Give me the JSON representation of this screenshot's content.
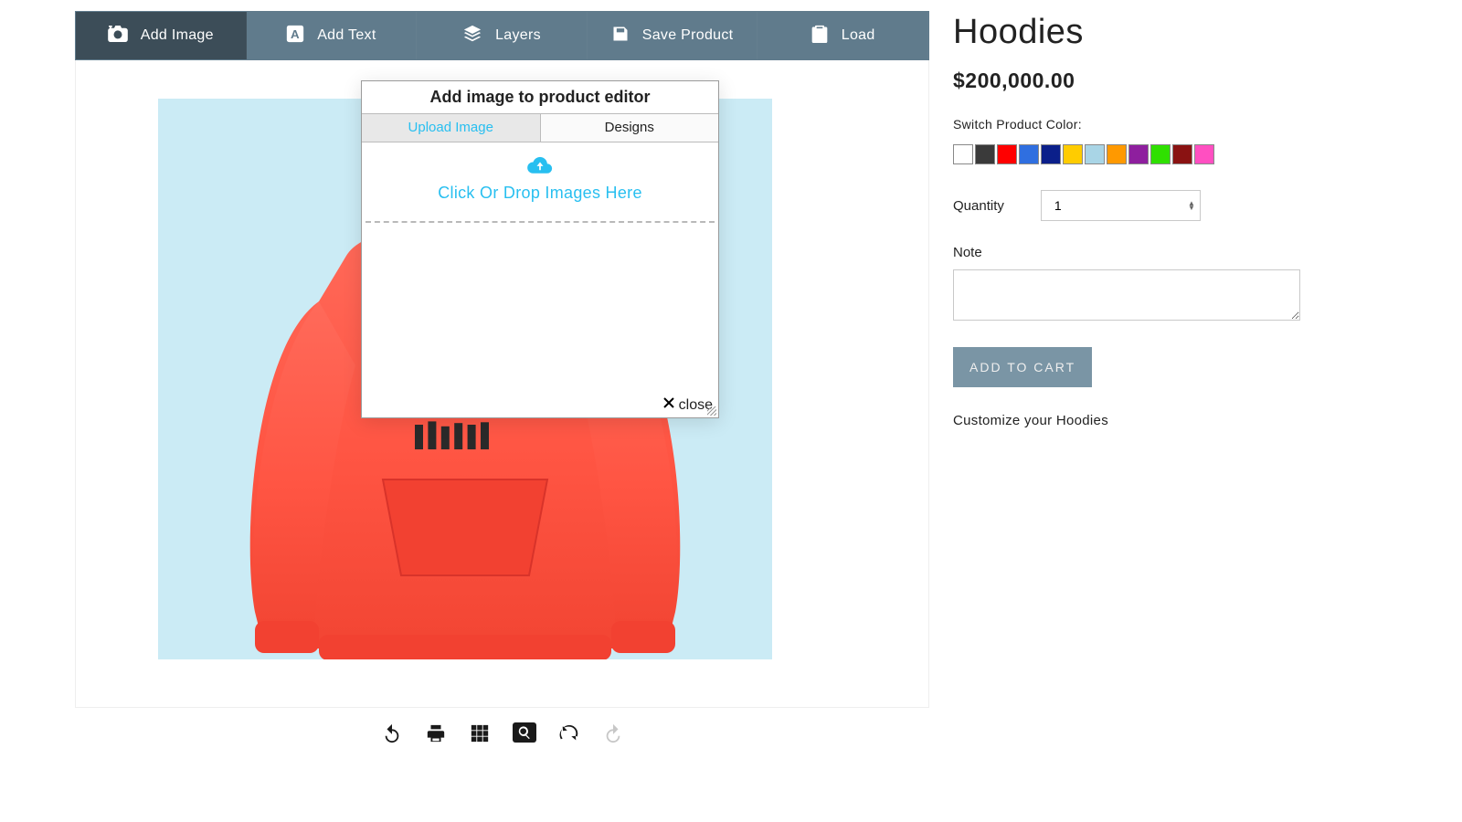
{
  "toolbar": {
    "add_image": "Add Image",
    "add_text": "Add Text",
    "layers": "Layers",
    "save_product": "Save Product",
    "load": "Load"
  },
  "modal": {
    "title": "Add image to product editor",
    "tab_upload": "Upload Image",
    "tab_designs": "Designs",
    "drop_text": "Click Or Drop Images Here",
    "close_label": "close"
  },
  "product": {
    "title": "Hoodies",
    "price": "$200,000.00",
    "color_label": "Switch Product Color:",
    "colors": [
      "#ffffff",
      "#3a3a3a",
      "#ff0000",
      "#2f6fe0",
      "#0b1f8a",
      "#ffcc00",
      "#a9d5e6",
      "#ff9900",
      "#8e1f9e",
      "#2fe000",
      "#8a1212",
      "#ff4fc1"
    ],
    "quantity_label": "Quantity",
    "quantity_value": "1",
    "note_label": "Note",
    "note_value": "",
    "cart_button": "ADD TO CART",
    "description": "Customize your Hoodies"
  }
}
